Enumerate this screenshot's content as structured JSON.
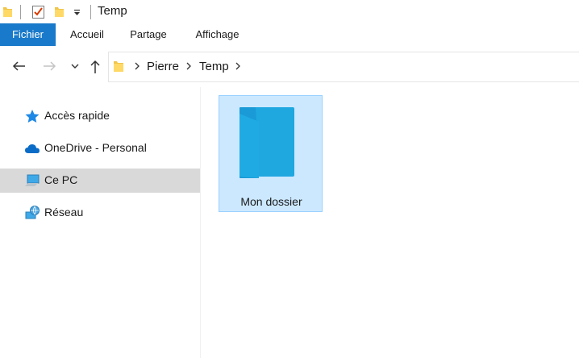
{
  "titlebar": {
    "title": "Temp",
    "quick_access": [
      "folder-icon",
      "properties-icon",
      "new-folder-icon",
      "customize-qat-icon"
    ]
  },
  "ribbon": {
    "tabs": [
      {
        "label": "Fichier",
        "active": true
      },
      {
        "label": "Accueil",
        "active": false
      },
      {
        "label": "Partage",
        "active": false
      },
      {
        "label": "Affichage",
        "active": false
      }
    ],
    "file_tab_color": "#1979ca"
  },
  "address": {
    "breadcrumb": [
      "Pierre",
      "Temp"
    ]
  },
  "navigation_pane": {
    "items": [
      {
        "label": "Accès rapide",
        "icon": "star-icon",
        "selected": false
      },
      {
        "label": "OneDrive - Personal",
        "icon": "cloud-icon",
        "selected": false
      },
      {
        "label": "Ce PC",
        "icon": "computer-icon",
        "selected": true
      },
      {
        "label": "Réseau",
        "icon": "network-icon",
        "selected": false
      }
    ]
  },
  "content": {
    "items": [
      {
        "label": "Mon dossier",
        "type": "folder",
        "selected": true
      }
    ],
    "selection_color": "#cce8ff",
    "folder_color": "#1ba1e2"
  }
}
